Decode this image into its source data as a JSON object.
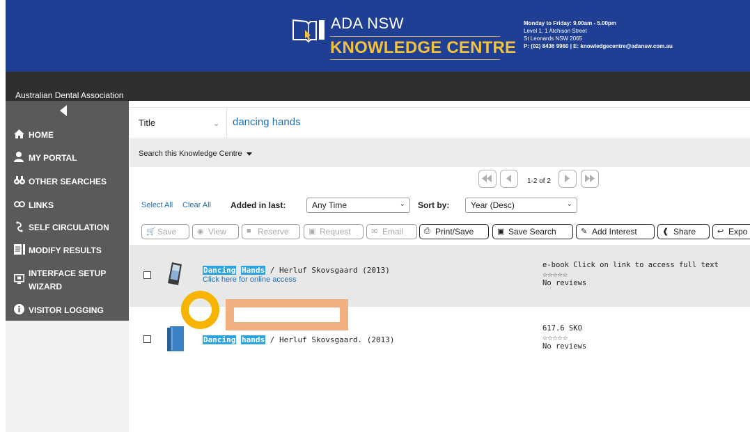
{
  "header": {
    "logo_line1": "ADA NSW",
    "logo_line2": "KNOWLEDGE CENTRE",
    "contact": {
      "hours": "Monday to Friday: 9.00am - 5.00pm",
      "address1": "Level 1, 1 Atchison Street",
      "address2": "St Leonards NSW 2065",
      "phone_email": "P: (02) 8436 9960 | E: knowledgecentre@adansw.com.au"
    }
  },
  "org_name": "Australian Dental Association",
  "sidebar": {
    "items": [
      {
        "label": "HOME",
        "icon": "home-icon"
      },
      {
        "label": "MY PORTAL",
        "icon": "user-icon"
      },
      {
        "label": "OTHER SEARCHES",
        "icon": "binoculars-icon"
      },
      {
        "label": "LINKS",
        "icon": "link-icon"
      },
      {
        "label": "SELF CIRCULATION",
        "icon": "circulation-icon"
      },
      {
        "label": "MODIFY RESULTS",
        "icon": "document-icon"
      },
      {
        "label": "INTERFACE SETUP",
        "label2": "WIZARD",
        "icon": "monitor-icon"
      },
      {
        "label": "VISITOR LOGGING",
        "icon": "info-icon"
      }
    ]
  },
  "search": {
    "field": "Title",
    "query": "dancing hands",
    "scope": "Search this Knowledge Centre"
  },
  "pager": {
    "text": "1-2 of 2"
  },
  "filters": {
    "select_all": "Select All",
    "clear_all": "Clear All",
    "added_label": "Added in last:",
    "added_value": "Any Time",
    "sort_label": "Sort by:",
    "sort_value": "Year (Desc)"
  },
  "actions": {
    "save": "Save",
    "view": "View",
    "reserve": "Reserve",
    "request": "Request",
    "email": "Email",
    "print": "Print/Save",
    "save_search": "Save Search",
    "add_interest": "Add Interest",
    "share": "Share",
    "export": "Expo"
  },
  "results": [
    {
      "title_w1": "Dancing",
      "title_w2": "Hands",
      "rest": " / Herluf Skovsgaard  (2013)",
      "link": "Click here for online access",
      "meta_line1": "e-book Click on link to access full text",
      "stars": "☆☆☆☆☆",
      "reviews": "No reviews"
    },
    {
      "title_w1": "Dancing",
      "title_w2": "hands",
      "rest": " / Herluf Skovsgaard.  (2013)",
      "meta_line1": "617.6 SKO",
      "stars": "☆☆☆☆☆",
      "reviews": "No reviews"
    }
  ]
}
